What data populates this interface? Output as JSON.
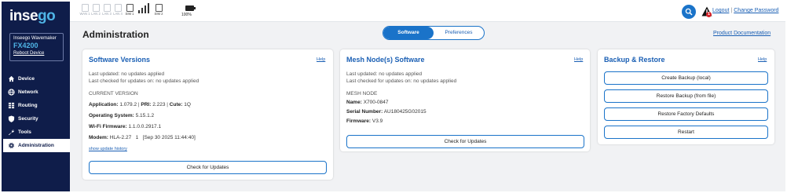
{
  "brand": {
    "part1": "inse",
    "part2": "go"
  },
  "device": {
    "name": "Inseego Wavemaker",
    "model": "FX4200",
    "reboot": "Reboot Device"
  },
  "nav": [
    {
      "label": "Device",
      "icon": "home-icon",
      "active": false
    },
    {
      "label": "Network",
      "icon": "globe-icon",
      "active": false
    },
    {
      "label": "Routing",
      "icon": "routing-icon",
      "active": false
    },
    {
      "label": "Security",
      "icon": "shield-icon",
      "active": false
    },
    {
      "label": "Tools",
      "icon": "wrench-icon",
      "active": false
    },
    {
      "label": "Administration",
      "icon": "gear-icon",
      "active": true
    }
  ],
  "status": {
    "indicators": [
      {
        "label": "WAN 1",
        "active": false
      },
      {
        "label": "LAN 2",
        "active": false
      },
      {
        "label": "LAN 3",
        "active": false
      },
      {
        "label": "LAN 4",
        "active": false
      },
      {
        "label": "SIM 1",
        "active": true
      },
      {
        "label": "SIM 2",
        "active": true
      }
    ],
    "signal_bars": 4,
    "battery": "100%"
  },
  "header": {
    "logout": "Logout",
    "separator": "|",
    "change_password": "Change Password",
    "alert_count": "1"
  },
  "page": {
    "title": "Administration",
    "tabs": [
      {
        "label": "Software",
        "active": true
      },
      {
        "label": "Preferences",
        "active": false
      }
    ],
    "product_doc": "Product Documentation"
  },
  "software_versions": {
    "title": "Software Versions",
    "help": "Help",
    "last_updated": "Last updated: no updates applied",
    "last_checked": "Last checked for updates on: no updates applied",
    "current_version": "CURRENT VERSION",
    "application_label": "Application:",
    "application_value": "1.079.2",
    "pri_label": "PRI:",
    "pri_value": "2.223",
    "cute_label": "Cute:",
    "cute_value": "1Q",
    "os_label": "Operating System:",
    "os_value": "5.15.1.2",
    "wifi_label": "Wi-Fi Firmware:",
    "wifi_value": "1.1.0.0.2917.1",
    "modem_label": "Modem:",
    "modem_value": "HLA-2.27   1   [Sep 30 2025 11:44:40]",
    "history_link": "show update history",
    "check_button": "Check for Updates"
  },
  "mesh": {
    "title": "Mesh Node(s) Software",
    "help": "Help",
    "last_updated": "Last updated: no updates applied",
    "last_checked": "Last checked for updates on: no updates applied",
    "mesh_node": "MESH NODE",
    "name_label": "Name:",
    "name_value": "X700-0847",
    "serial_label": "Serial Number:",
    "serial_value": "AU180425G02015",
    "firmware_label": "Firmware:",
    "firmware_value": "V3.9",
    "check_button": "Check for Updates"
  },
  "backup": {
    "title": "Backup & Restore",
    "help": "Help",
    "buttons": [
      "Create Backup (local)",
      "Restore Backup (from file)",
      "Restore Factory Defaults",
      "Restart"
    ]
  },
  "colors": {
    "sidebar": "#0f1d4a",
    "accent": "#1a73c9",
    "link": "#1a5fb4",
    "brand_go": "#4fb4e6",
    "alert": "#d6232a"
  }
}
